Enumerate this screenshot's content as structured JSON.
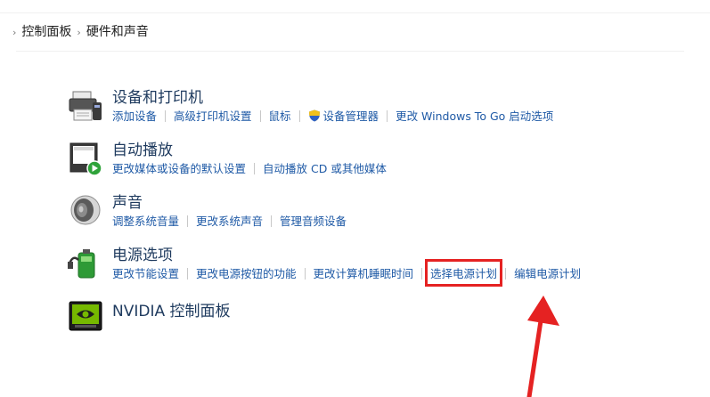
{
  "breadcrumb": {
    "items": [
      "控制面板",
      "硬件和声音"
    ]
  },
  "categories": [
    {
      "title": "设备和打印机",
      "links": [
        "添加设备",
        "高级打印机设置",
        "鼠标",
        "设备管理器",
        "更改 Windows To Go 启动选项"
      ]
    },
    {
      "title": "自动播放",
      "links": [
        "更改媒体或设备的默认设置",
        "自动播放 CD 或其他媒体"
      ]
    },
    {
      "title": "声音",
      "links": [
        "调整系统音量",
        "更改系统声音",
        "管理音频设备"
      ]
    },
    {
      "title": "电源选项",
      "links": [
        "更改节能设置",
        "更改电源按钮的功能",
        "更改计算机睡眠时间",
        "选择电源计划",
        "编辑电源计划"
      ]
    },
    {
      "title": "NVIDIA 控制面板",
      "links": []
    }
  ],
  "highlight": {
    "target": "选择电源计划",
    "color": "#e52222"
  },
  "colors": {
    "title": "#1e3a5e",
    "link": "#1f5aa6",
    "annotation": "#e52222"
  }
}
